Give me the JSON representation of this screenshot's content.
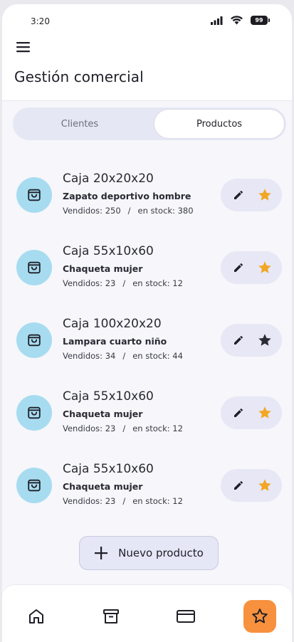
{
  "status_bar": {
    "time": "3:20",
    "battery": "99"
  },
  "header": {
    "title": "Gestión comercial"
  },
  "tabs": [
    {
      "label": "Clientes",
      "active": false
    },
    {
      "label": "Productos",
      "active": true
    }
  ],
  "products": [
    {
      "title": "Caja 20x20x20",
      "subtitle": "Zapato deportivo hombre",
      "sold": "Vendidos: 250",
      "separator": "/",
      "stock": "en stock: 380",
      "favorite": true
    },
    {
      "title": "Caja 55x10x60",
      "subtitle": "Chaqueta mujer",
      "sold": "Vendidos: 23",
      "separator": "/",
      "stock": "en stock: 12",
      "favorite": true
    },
    {
      "title": "Caja 100x20x20",
      "subtitle": "Lampara cuarto niño",
      "sold": "Vendidos: 34",
      "separator": "/",
      "stock": "en stock: 44",
      "favorite": false
    },
    {
      "title": "Caja 55x10x60",
      "subtitle": "Chaqueta mujer",
      "sold": "Vendidos: 23",
      "separator": "/",
      "stock": "en stock: 12",
      "favorite": true
    },
    {
      "title": "Caja 55x10x60",
      "subtitle": "Chaqueta mujer",
      "sold": "Vendidos: 23",
      "separator": "/",
      "stock": "en stock: 12",
      "favorite": true
    }
  ],
  "new_product_button": {
    "label": "Nuevo producto"
  },
  "bottom_nav": [
    {
      "icon": "home-icon",
      "active": false
    },
    {
      "icon": "archive-icon",
      "active": false
    },
    {
      "icon": "card-icon",
      "active": false
    },
    {
      "icon": "star-icon",
      "active": true
    }
  ],
  "colors": {
    "accent": "#f7913d",
    "favorite": "#f2a623",
    "avatar": "#a7dcf0",
    "chip": "#e7e7f5"
  }
}
